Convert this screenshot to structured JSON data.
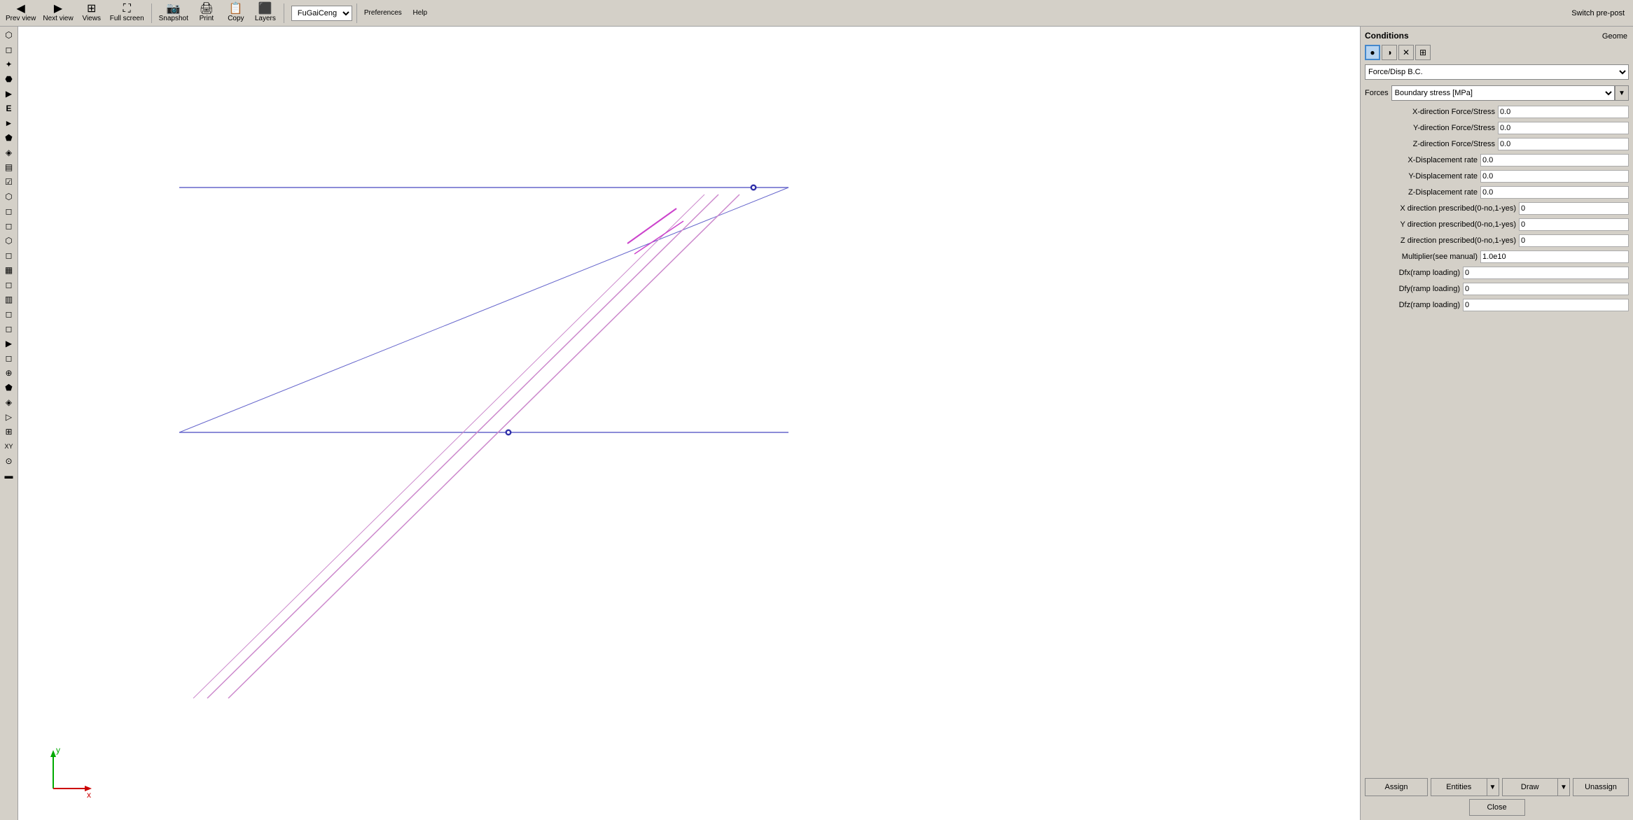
{
  "toolbar": {
    "prev_view_label": "Prev view",
    "next_view_label": "Next view",
    "views_label": "Views",
    "full_screen_label": "Full screen",
    "snapshot_label": "Snapshot",
    "print_label": "Print",
    "copy_label": "Copy",
    "layers_label": "Layers",
    "layer_value": "FuGaiCeng",
    "preferences_label": "Preferences",
    "help_label": "Help",
    "switch_pre_post_label": "Switch pre-post",
    "geome_label": "Geome"
  },
  "left_tools": [
    "⬡",
    "◻",
    "✦",
    "⬣",
    "▶",
    "E",
    "►",
    "⬟",
    "◈",
    "▤",
    "☑",
    "⬡",
    "◻",
    "◻",
    "⬡",
    "◻",
    "▦",
    "◻",
    "▥",
    "◻",
    "◻",
    "▶",
    "◻",
    "⊕",
    "⬟",
    "◈",
    "▷",
    "⊞",
    "XY",
    "⊙",
    "▬"
  ],
  "panel": {
    "title": "Conditions",
    "icons": [
      "●",
      "◑",
      "✕",
      "⊞"
    ],
    "bc_type": "Force/Disp B.C.",
    "forces_label": "Forces",
    "forces_type": "Boundary stress [MPa]",
    "fields": [
      {
        "label": "X-direction Force/Stress",
        "value": "0.0"
      },
      {
        "label": "Y-direction Force/Stress",
        "value": "0.0"
      },
      {
        "label": "Z-direction Force/Stress",
        "value": "0.0"
      },
      {
        "label": "X-Displacement rate",
        "value": "0.0"
      },
      {
        "label": "Y-Displacement rate",
        "value": "0.0"
      },
      {
        "label": "Z-Displacement rate",
        "value": "0.0"
      },
      {
        "label": "X direction prescribed(0-no,1-yes)",
        "value": "0"
      },
      {
        "label": "Y direction prescribed(0-no,1-yes)",
        "value": "0"
      },
      {
        "label": "Z direction prescribed(0-no,1-yes)",
        "value": "0"
      },
      {
        "label": "Multiplier(see manual)",
        "value": "1.0e10"
      },
      {
        "label": "Dfx(ramp loading)",
        "value": "0"
      },
      {
        "label": "Dfy(ramp loading)",
        "value": "0"
      },
      {
        "label": "Dfz(ramp loading)",
        "value": "0"
      }
    ],
    "assign_label": "Assign",
    "entities_label": "Entities",
    "draw_label": "Draw",
    "unassign_label": "Unassign",
    "close_label": "Close"
  },
  "axis": {
    "x_label": "x",
    "y_label": "y"
  }
}
